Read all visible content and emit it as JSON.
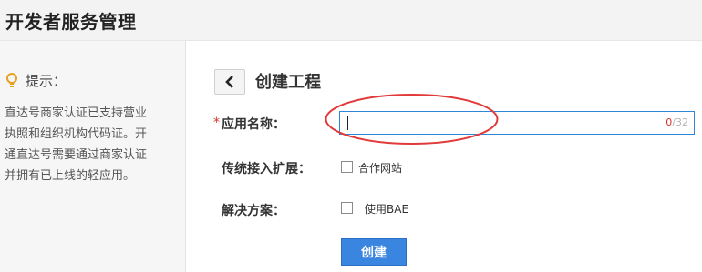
{
  "header": {
    "title": "开发者服务管理"
  },
  "sidebar": {
    "tip_title": "提示：",
    "tip_lines": [
      "直达号商家认证已支持营业",
      "执照和组织机构代码证。开",
      "通直达号需要通过商家认证",
      "并拥有已上线的轻应用。"
    ]
  },
  "main": {
    "heading": "创建工程",
    "required_mark": "*",
    "app_name_label": "应用名称：",
    "app_name_value": "",
    "app_name_count": "0",
    "app_name_max": "/32",
    "extension_label": "传统接入扩展：",
    "extension_option": "合作网站",
    "extension_checked": false,
    "solution_label": "解决方案：",
    "solution_option": "使用BAE",
    "solution_checked": false,
    "submit_label": "创建"
  },
  "colors": {
    "accent": "#3a85e0",
    "required": "#d9302b",
    "annotation": "#e03a3a",
    "bulb": "#e8a020"
  },
  "icons": {
    "back": "chevron-left-icon",
    "tip": "lightbulb-icon"
  }
}
